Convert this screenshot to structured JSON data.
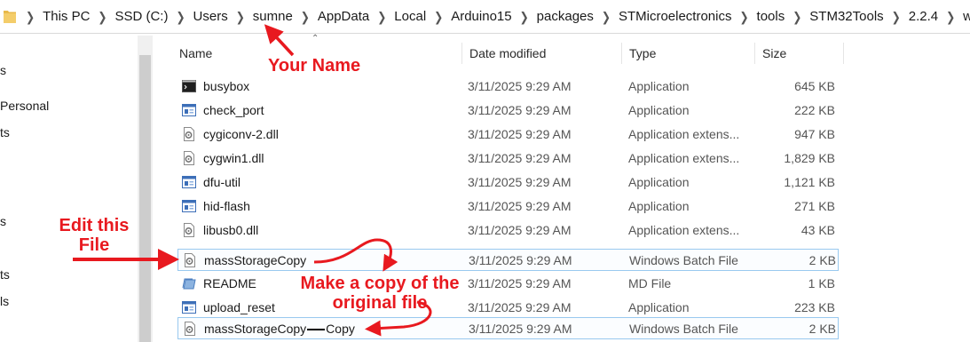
{
  "breadcrumb": [
    "This PC",
    "SSD (C:)",
    "Users",
    "sumne",
    "AppData",
    "Local",
    "Arduino15",
    "packages",
    "STMicroelectronics",
    "tools",
    "STM32Tools",
    "2.2.4",
    "win"
  ],
  "nav": {
    "items": [
      "s",
      "Personal",
      "ts",
      "s",
      "ts",
      "ls"
    ]
  },
  "columns": {
    "name": "Name",
    "date": "Date modified",
    "type": "Type",
    "size": "Size"
  },
  "files": [
    {
      "name": "busybox",
      "date": "3/11/2025 9:29 AM",
      "type": "Application",
      "size": "645 KB",
      "icon": "console-app-icon"
    },
    {
      "name": "check_port",
      "date": "3/11/2025 9:29 AM",
      "type": "Application",
      "size": "222 KB",
      "icon": "app-window-icon"
    },
    {
      "name": "cygiconv-2.dll",
      "date": "3/11/2025 9:29 AM",
      "type": "Application extens...",
      "size": "947 KB",
      "icon": "dll-gear-icon"
    },
    {
      "name": "cygwin1.dll",
      "date": "3/11/2025 9:29 AM",
      "type": "Application extens...",
      "size": "1,829 KB",
      "icon": "dll-gear-icon"
    },
    {
      "name": "dfu-util",
      "date": "3/11/2025 9:29 AM",
      "type": "Application",
      "size": "1,121 KB",
      "icon": "app-window-icon"
    },
    {
      "name": "hid-flash",
      "date": "3/11/2025 9:29 AM",
      "type": "Application",
      "size": "271 KB",
      "icon": "app-window-icon"
    },
    {
      "name": "libusb0.dll",
      "date": "3/11/2025 9:29 AM",
      "type": "Application extens...",
      "size": "43 KB",
      "icon": "dll-gear-icon"
    },
    {
      "name": "massStorageCopy",
      "date": "3/11/2025 9:29 AM",
      "type": "Windows Batch File",
      "size": "2 KB",
      "icon": "batch-gear-icon",
      "selected": true
    },
    {
      "name": "README",
      "date": "3/11/2025 9:29 AM",
      "type": "MD File",
      "size": "1 KB",
      "icon": "md-file-icon"
    },
    {
      "name": "upload_reset",
      "date": "3/11/2025 9:29 AM",
      "type": "Application",
      "size": "223 KB",
      "icon": "app-window-icon"
    },
    {
      "name": "massStorageCopy",
      "date": "3/11/2025 9:29 AM",
      "type": "Windows Batch File",
      "size": "2 KB",
      "icon": "batch-gear-icon",
      "selected": true
    }
  ],
  "annotations": {
    "your_name": "Your Name",
    "edit_line1": "Edit this",
    "edit_line2": "File",
    "copy_line1": "Make a copy of the",
    "copy_line2": "original file",
    "copy_suffix": "Copy"
  },
  "colors": {
    "annotation": "#e8191f",
    "selection_border": "#99c9ef"
  }
}
